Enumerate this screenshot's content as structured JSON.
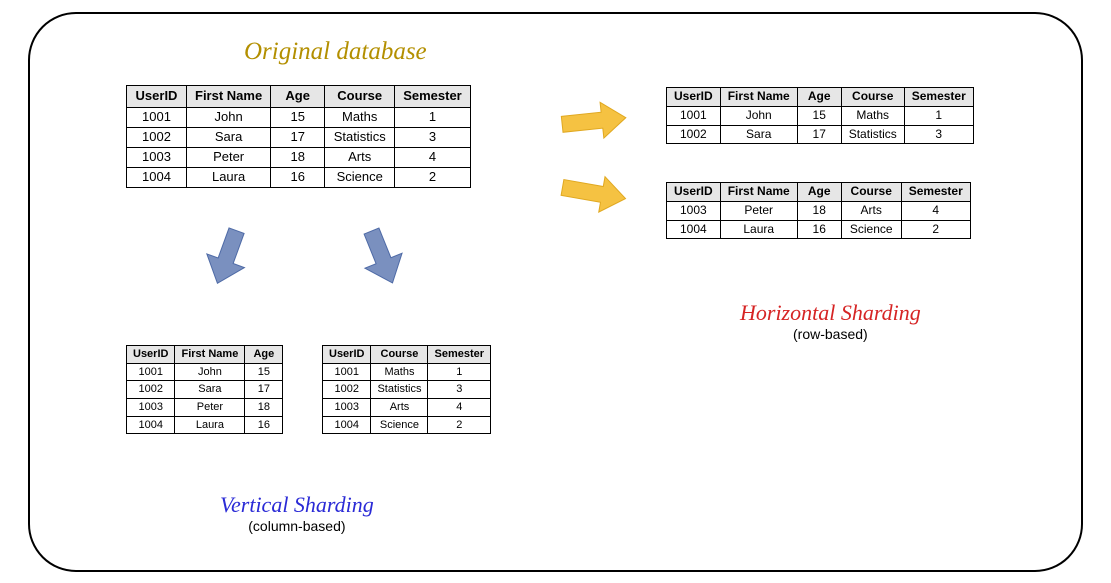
{
  "titles": {
    "original": "Original database",
    "vertical": "Vertical Sharding",
    "vertical_sub": "(column-based)",
    "horizontal": "Horizontal Sharding",
    "horizontal_sub": "(row-based)"
  },
  "headers": {
    "userId": "UserID",
    "firstName": "First Name",
    "age": "Age",
    "course": "Course",
    "semester": "Semester"
  },
  "original": {
    "rows": [
      {
        "userId": "1001",
        "firstName": "John",
        "age": "15",
        "course": "Maths",
        "semester": "1"
      },
      {
        "userId": "1002",
        "firstName": "Sara",
        "age": "17",
        "course": "Statistics",
        "semester": "3"
      },
      {
        "userId": "1003",
        "firstName": "Peter",
        "age": "18",
        "course": "Arts",
        "semester": "4"
      },
      {
        "userId": "1004",
        "firstName": "Laura",
        "age": "16",
        "course": "Science",
        "semester": "2"
      }
    ]
  },
  "verticalA": {
    "rows": [
      {
        "userId": "1001",
        "firstName": "John",
        "age": "15"
      },
      {
        "userId": "1002",
        "firstName": "Sara",
        "age": "17"
      },
      {
        "userId": "1003",
        "firstName": "Peter",
        "age": "18"
      },
      {
        "userId": "1004",
        "firstName": "Laura",
        "age": "16"
      }
    ]
  },
  "verticalB": {
    "rows": [
      {
        "userId": "1001",
        "course": "Maths",
        "semester": "1"
      },
      {
        "userId": "1002",
        "course": "Statistics",
        "semester": "3"
      },
      {
        "userId": "1003",
        "course": "Arts",
        "semester": "4"
      },
      {
        "userId": "1004",
        "course": "Science",
        "semester": "2"
      }
    ]
  },
  "horizontalA": {
    "rows": [
      {
        "userId": "1001",
        "firstName": "John",
        "age": "15",
        "course": "Maths",
        "semester": "1"
      },
      {
        "userId": "1002",
        "firstName": "Sara",
        "age": "17",
        "course": "Statistics",
        "semester": "3"
      }
    ]
  },
  "horizontalB": {
    "rows": [
      {
        "userId": "1003",
        "firstName": "Peter",
        "age": "18",
        "course": "Arts",
        "semester": "4"
      },
      {
        "userId": "1004",
        "firstName": "Laura",
        "age": "16",
        "course": "Science",
        "semester": "2"
      }
    ]
  }
}
